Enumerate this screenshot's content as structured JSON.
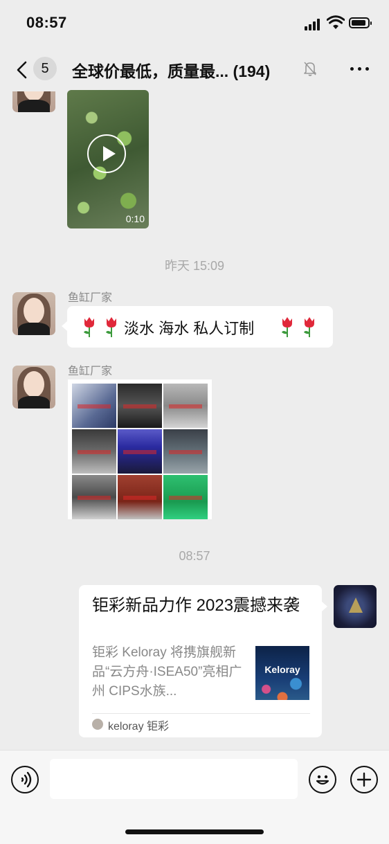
{
  "status_bar": {
    "time": "08:57"
  },
  "nav": {
    "unread_count": "5",
    "title": "全球价最低，质量最... (194)"
  },
  "messages": {
    "video": {
      "duration": "0:10"
    },
    "timestamp_1": "昨天 15:09",
    "text_msg": {
      "sender": "鱼缸厂家",
      "text": "淡水 海水 私人订制"
    },
    "image_msg": {
      "sender": "鱼缸厂家"
    },
    "timestamp_2": "08:57",
    "link_card": {
      "title": "钜彩新品力作 2023震撼来袭",
      "description": "钜彩 Keloray 将携旗舰新品“云方舟·ISEA50”亮相广州 CIPS水族...",
      "thumb_brand": "Keloray",
      "source": "keloray 钜彩"
    }
  },
  "input_bar": {
    "placeholder": ""
  },
  "colors": {
    "background": "#ededed",
    "bubble": "#ffffff",
    "meta_text": "#a8a8a8"
  },
  "icons": [
    "back-chevron-icon",
    "mute-bell-icon",
    "more-icon",
    "play-icon",
    "tulip-icon",
    "voice-icon",
    "emoji-icon",
    "plus-icon"
  ]
}
